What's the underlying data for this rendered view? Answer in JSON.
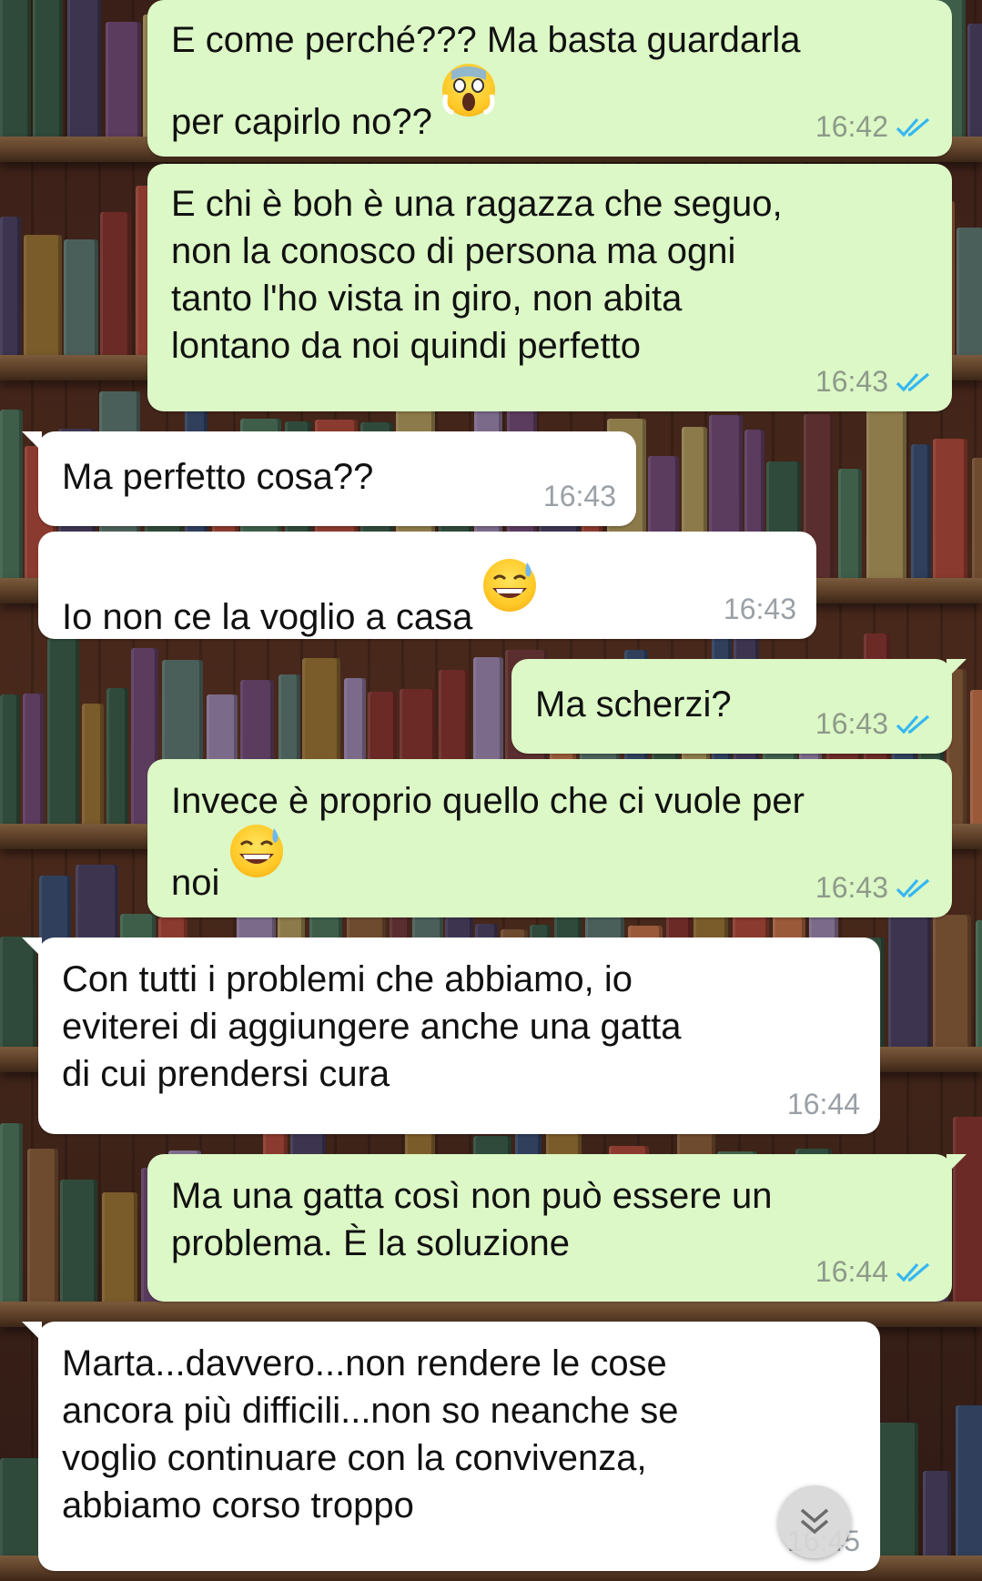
{
  "messages": [
    {
      "side": "out",
      "text": "E come perché??? Ma basta guardarla\nper capirlo no?? ",
      "emoji": "scream-emoji",
      "time": "16:42",
      "read": true
    },
    {
      "side": "out",
      "text": "E chi è boh è una ragazza che seguo,\nnon la conosco di persona ma ogni\ntanto l'ho vista in giro, non abita\nlontano da noi quindi perfetto",
      "time": "16:43",
      "read": true
    },
    {
      "side": "in",
      "text": "Ma perfetto cosa??",
      "time": "16:43"
    },
    {
      "side": "in",
      "text": "Io non ce la voglio a casa ",
      "emoji": "grinning-sweat-emoji",
      "time": "16:43"
    },
    {
      "side": "out",
      "text": "Ma scherzi?",
      "time": "16:43",
      "read": true
    },
    {
      "side": "out",
      "text": "Invece è proprio quello che ci vuole per\nnoi ",
      "emoji": "grinning-sweat-emoji",
      "time": "16:43",
      "read": true
    },
    {
      "side": "in",
      "text": "Con tutti i problemi che abbiamo, io\neviterei di aggiungere anche una gatta\ndi cui prendersi cura",
      "time": "16:44"
    },
    {
      "side": "out",
      "text": "Ma una gatta così non può essere un\nproblema. È la soluzione",
      "time": "16:44",
      "read": true
    },
    {
      "side": "in",
      "text": "Marta...davvero...non rendere le cose\nancora più difficili...non so neanche se\nvoglio continuare con la convivenza,\nabbiamo corso troppo",
      "time": "16:45"
    }
  ],
  "colors": {
    "outgoing": "#dcf8c6",
    "incoming": "#ffffff",
    "read_tick": "#34b7f1"
  },
  "icons": {
    "read": "double-check-icon",
    "scroll": "chevron-down-icon"
  }
}
